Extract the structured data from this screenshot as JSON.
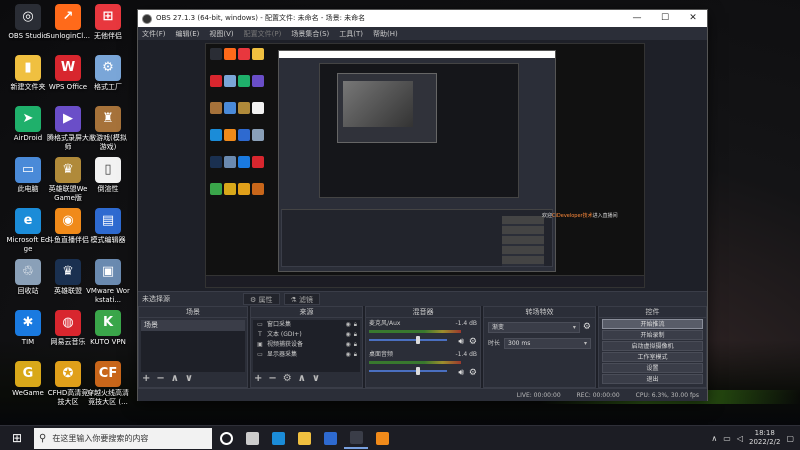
{
  "desktop": {
    "icons": [
      {
        "label": "OBS Studio",
        "glyph": "◎",
        "color": "#2a2d35"
      },
      {
        "label": "SunloginCl...",
        "glyph": "↗",
        "color": "#ff6a1a"
      },
      {
        "label": "无他伴侣",
        "glyph": "⊞",
        "color": "#e8373e"
      },
      {
        "label": "新建文件夹",
        "glyph": "▮",
        "color": "#f0c040"
      },
      {
        "label": "WPS Office",
        "glyph": "W",
        "color": "#d8262e"
      },
      {
        "label": "格式工厂",
        "glyph": "⚙",
        "color": "#7aa6d8"
      },
      {
        "label": "AirDroid",
        "glyph": "➤",
        "color": "#1fb06b"
      },
      {
        "label": "腾格式录屏大师",
        "glyph": "▶",
        "color": "#6a4ec8"
      },
      {
        "label": "敝游戏(模拟游戏)",
        "glyph": "♜",
        "color": "#a6723a"
      },
      {
        "label": "此电脑",
        "glyph": "▭",
        "color": "#4a8ad8"
      },
      {
        "label": "英雄联盟WeGame版",
        "glyph": "♛",
        "color": "#b08a3a"
      },
      {
        "label": "倒渲性",
        "glyph": "▯",
        "color": "#f2f2f2"
      },
      {
        "label": "Microsoft Edge",
        "glyph": "e",
        "color": "#1b8cd8"
      },
      {
        "label": "斗鱼直播伴侣",
        "glyph": "◉",
        "color": "#f08a1a"
      },
      {
        "label": "模式编辑器",
        "glyph": "▤",
        "color": "#2e6ad0"
      },
      {
        "label": "回收站",
        "glyph": "♲",
        "color": "#8aa0b8"
      },
      {
        "label": "英雄联盟",
        "glyph": "♛",
        "color": "#1a3050"
      },
      {
        "label": "VMware Workstati...",
        "glyph": "▣",
        "color": "#6a8ab0"
      },
      {
        "label": "TIM",
        "glyph": "✱",
        "color": "#1a7ae0"
      },
      {
        "label": "网易云音乐",
        "glyph": "◍",
        "color": "#d8262e"
      },
      {
        "label": "KUTO VPN",
        "glyph": "K",
        "color": "#3aa64a"
      },
      {
        "label": "WeGame",
        "glyph": "G",
        "color": "#d8a81a"
      },
      {
        "label": "CFHD高清竞技大区",
        "glyph": "✪",
        "color": "#e0a01a"
      },
      {
        "label": "穿越火线高清竞技大区 (...",
        "glyph": "CF",
        "color": "#c8661a"
      }
    ]
  },
  "window": {
    "title": "OBS 27.1.3 (64-bit, windows) - 配置文件: 未命名 - 场景: 未命名",
    "controls": {
      "min": "—",
      "max": "☐",
      "close": "✕"
    }
  },
  "menu": [
    "文件(F)",
    "编辑(E)",
    "视图(V)",
    "配置文件(P)",
    "场景集合(S)",
    "工具(T)",
    "帮助(H)"
  ],
  "preview": {
    "note_white": "欢迎",
    "note_orange": "CiDeveloper技术",
    "note_rest": "进入直播间"
  },
  "context": {
    "no_source": "未选择源",
    "properties": "⚙ 属性",
    "filters": "⚗ 滤镜"
  },
  "scenes": {
    "title": "场景",
    "items": [
      "场景"
    ],
    "footer": [
      "+",
      "−",
      "∧",
      "∨"
    ]
  },
  "sources": {
    "title": "来源",
    "items": [
      {
        "icon": "▭",
        "name": "窗口采集"
      },
      {
        "icon": "T",
        "name": "文本 (GDI+)"
      },
      {
        "icon": "▣",
        "name": "视频捕获设备"
      },
      {
        "icon": "▭",
        "name": "显示器采集"
      }
    ],
    "footer": [
      "+",
      "−",
      "⚙",
      "∧",
      "∨"
    ]
  },
  "mixer": {
    "title": "混音器",
    "channels": [
      {
        "name": "麦克风/Aux",
        "db": "-1.4 dB",
        "level": 0.6
      },
      {
        "name": "桌面音频",
        "db": "-1.4 dB",
        "level": 0.6
      }
    ]
  },
  "transitions": {
    "title": "转场特效",
    "type": "渐变",
    "duration_label": "时长",
    "duration": "300 ms"
  },
  "controls": {
    "title": "控件",
    "buttons": [
      "开始推流",
      "开始录制",
      "启动虚拟摄像机",
      "工作室模式",
      "设置",
      "退出"
    ]
  },
  "status": {
    "live": "LIVE: 00:00:00",
    "rec": "REC: 00:00:00",
    "cpu": "CPU: 6.3%, 30.00 fps"
  },
  "taskbar": {
    "search_placeholder": "在这里输入你要搜索的内容",
    "apps": [
      {
        "name": "cortana",
        "color": "#ffffff"
      },
      {
        "name": "task-view",
        "color": "#cccccc"
      },
      {
        "name": "edge",
        "color": "#1b8cd8"
      },
      {
        "name": "explorer",
        "color": "#f0c040"
      },
      {
        "name": "store",
        "color": "#2e6ad0"
      },
      {
        "name": "obs",
        "color": "#3a3d48"
      },
      {
        "name": "app",
        "color": "#f08a1a"
      }
    ],
    "time": "18:18",
    "date": "2022/2/2"
  }
}
